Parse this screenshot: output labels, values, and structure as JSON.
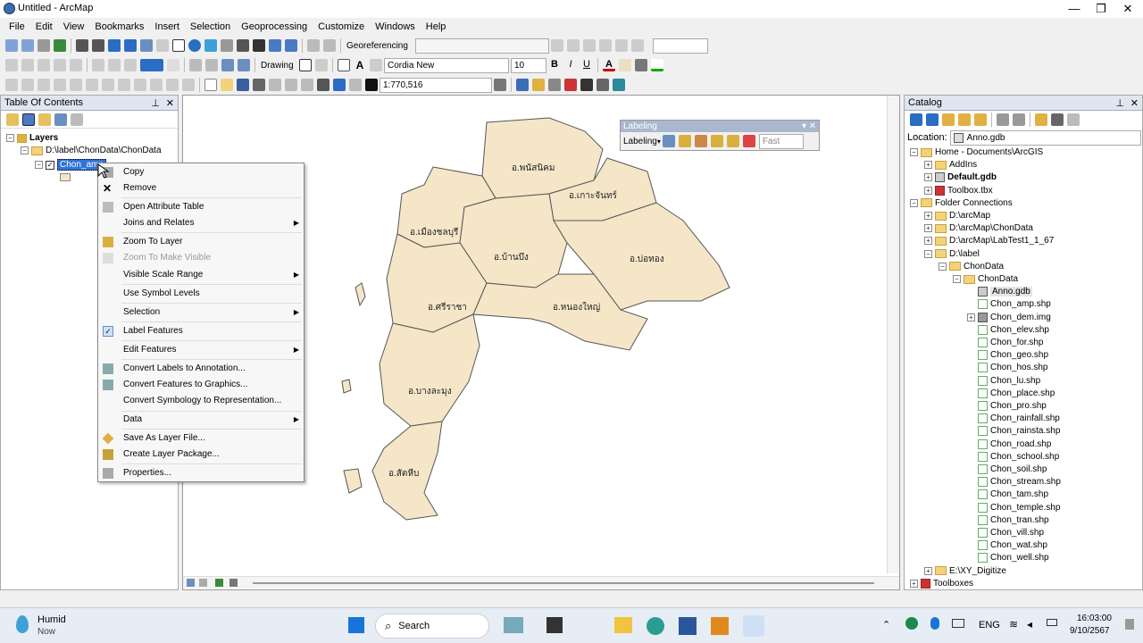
{
  "window": {
    "title": "Untitled - ArcMap",
    "minimize": "—",
    "maximize": "❐",
    "close": "✕"
  },
  "menu": [
    "File",
    "Edit",
    "View",
    "Bookmarks",
    "Insert",
    "Selection",
    "Geoprocessing",
    "Customize",
    "Windows",
    "Help"
  ],
  "toolbar": {
    "georeferencing": "Georeferencing",
    "drawing": "Drawing",
    "font": "Cordia New",
    "font_size": "10",
    "bold": "B",
    "italic": "I",
    "underline": "U",
    "scale": "1:770,516",
    "text_color_glyph": "A"
  },
  "toc": {
    "title": "Table Of Contents",
    "layers": "Layers",
    "path": "D:\\label\\ChonData\\ChonData",
    "layer": "Chon_amp"
  },
  "context_menu": {
    "items": [
      {
        "label": "Copy"
      },
      {
        "label": "Remove"
      },
      {
        "label": "Open Attribute Table"
      },
      {
        "label": "Joins and Relates"
      },
      {
        "label": "Zoom To Layer"
      },
      {
        "label": "Zoom To Make Visible"
      },
      {
        "label": "Visible Scale Range"
      },
      {
        "label": "Use Symbol Levels"
      },
      {
        "label": "Selection"
      },
      {
        "label": "Label Features"
      },
      {
        "label": "Edit Features"
      },
      {
        "label": "Convert Labels to Annotation..."
      },
      {
        "label": "Convert Features to Graphics..."
      },
      {
        "label": "Convert Symbology to Representation..."
      },
      {
        "label": "Data"
      },
      {
        "label": "Save As Layer File..."
      },
      {
        "label": "Create Layer Package..."
      },
      {
        "label": "Properties..."
      }
    ]
  },
  "labeling": {
    "title": "Labeling",
    "menu": "Labeling",
    "mode": "Fast"
  },
  "map": {
    "fill": "#f5e6c8",
    "stroke": "#555555",
    "labels": [
      "อ.พนัสนิคม",
      "อ.เกาะจันทร์",
      "อ.เมืองชลบุรี",
      "อ.บ้านบึง",
      "อ.บ่อทอง",
      "อ.ศรีราชา",
      "อ.หนองใหญ่",
      "อ.บางละมุง",
      "อ.สัตหีบ"
    ]
  },
  "catalog": {
    "title": "Catalog",
    "location_label": "Location:",
    "location": "Anno.gdb",
    "items": [
      "Home - Documents\\ArcGIS",
      "AddIns",
      "Default.gdb",
      "Toolbox.tbx",
      "Folder Connections",
      "D:\\arcMap",
      "D:\\arcMap\\ChonData",
      "D:\\arcMap\\LabTest1_1_67",
      "D:\\label",
      "ChonData",
      "ChonData",
      "Anno.gdb",
      "Chon_amp.shp",
      "Chon_dem.img",
      "Chon_elev.shp",
      "Chon_for.shp",
      "Chon_geo.shp",
      "Chon_hos.shp",
      "Chon_lu.shp",
      "Chon_place.shp",
      "Chon_pro.shp",
      "Chon_rainfall.shp",
      "Chon_rainsta.shp",
      "Chon_road.shp",
      "Chon_school.shp",
      "Chon_soil.shp",
      "Chon_stream.shp",
      "Chon_tam.shp",
      "Chon_temple.shp",
      "Chon_tran.shp",
      "Chon_vill.shp",
      "Chon_wat.shp",
      "Chon_well.shp",
      "E:\\XY_Digitize",
      "Toolboxes"
    ]
  },
  "taskbar": {
    "weather": "Humid",
    "weather_sub": "Now",
    "search": "Search",
    "lang": "ENG",
    "time": "16:03:00",
    "date": "9/10/2567"
  }
}
